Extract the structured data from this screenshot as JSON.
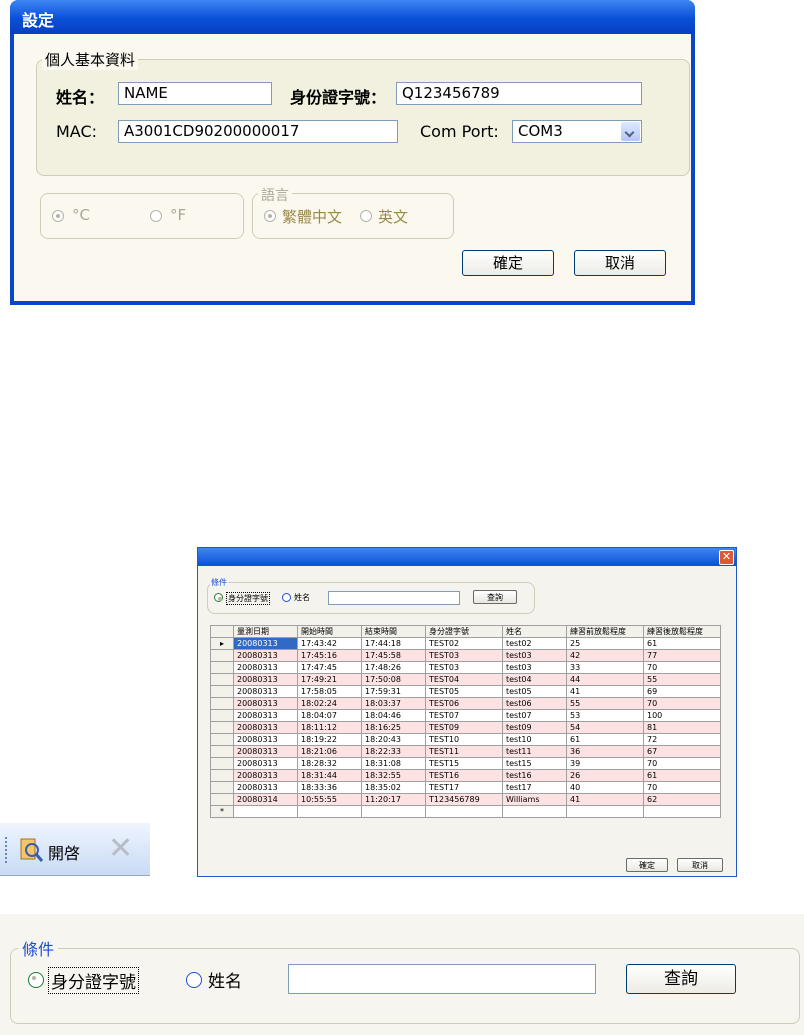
{
  "settings_dialog": {
    "title": "設定",
    "personal_group": {
      "legend": "個人基本資料",
      "name_label": "姓名：",
      "name_value": "NAME",
      "id_label": "身份證字號：",
      "id_value": "Q123456789",
      "mac_label": "MAC:",
      "mac_value": "A3001CD90200000017",
      "comport_label": "Com Port:",
      "comport_value": "COM3"
    },
    "unit_group": {
      "celsius": "°C",
      "fahrenheit": "°F"
    },
    "language_group": {
      "legend": "語言",
      "traditional_chinese": "繁體中文",
      "english": "英文"
    },
    "ok_label": "確定",
    "cancel_label": "取消"
  },
  "query_window": {
    "close_glyph": "✕",
    "criteria_legend": "條件",
    "opt_id": "身分證字號",
    "opt_name": "姓名",
    "search_label": "查詢",
    "columns": [
      "量測日期",
      "開始時間",
      "結束時間",
      "身分證字號",
      "姓名",
      "練習前放鬆程度",
      "練習後放鬆程度"
    ],
    "rows": [
      [
        "20080313",
        "17:43:42",
        "17:44:18",
        "TEST02",
        "test02",
        "25",
        "61"
      ],
      [
        "20080313",
        "17:45:16",
        "17:45:58",
        "TEST03",
        "test03",
        "42",
        "77"
      ],
      [
        "20080313",
        "17:47:45",
        "17:48:26",
        "TEST03",
        "test03",
        "33",
        "70"
      ],
      [
        "20080313",
        "17:49:21",
        "17:50:08",
        "TEST04",
        "test04",
        "44",
        "55"
      ],
      [
        "20080313",
        "17:58:05",
        "17:59:31",
        "TEST05",
        "test05",
        "41",
        "69"
      ],
      [
        "20080313",
        "18:02:24",
        "18:03:37",
        "TEST06",
        "test06",
        "55",
        "70"
      ],
      [
        "20080313",
        "18:04:07",
        "18:04:46",
        "TEST07",
        "test07",
        "53",
        "100"
      ],
      [
        "20080313",
        "18:11:12",
        "18:16:25",
        "TEST09",
        "test09",
        "54",
        "81"
      ],
      [
        "20080313",
        "18:19:22",
        "18:20:43",
        "TEST10",
        "test10",
        "61",
        "72"
      ],
      [
        "20080313",
        "18:21:06",
        "18:22:33",
        "TEST11",
        "test11",
        "36",
        "67"
      ],
      [
        "20080313",
        "18:28:32",
        "18:31:08",
        "TEST15",
        "test15",
        "39",
        "70"
      ],
      [
        "20080313",
        "18:31:44",
        "18:32:55",
        "TEST16",
        "test16",
        "26",
        "61"
      ],
      [
        "20080313",
        "18:33:36",
        "18:35:02",
        "TEST17",
        "test17",
        "40",
        "70"
      ],
      [
        "20080314",
        "10:55:55",
        "11:20:17",
        "T123456789",
        "Williams",
        "41",
        "62"
      ]
    ],
    "current_row_marker": "▸",
    "new_row_marker": "*",
    "ok_label": "確定",
    "cancel_label": "取消"
  },
  "toolbar": {
    "open_label": "開啓",
    "delete_glyph": "✕"
  },
  "criteria_panel": {
    "legend": "條件",
    "opt_id": "身分證字號",
    "opt_name": "姓名",
    "search_label": "查詢"
  },
  "colors": {
    "xp_blue": "#0a46c8",
    "dialog_bg": "#fbf9ef",
    "group_bg": "#f2f1e0",
    "row_pink": "#fde2e4",
    "legend_blue": "#1c4fd6"
  }
}
